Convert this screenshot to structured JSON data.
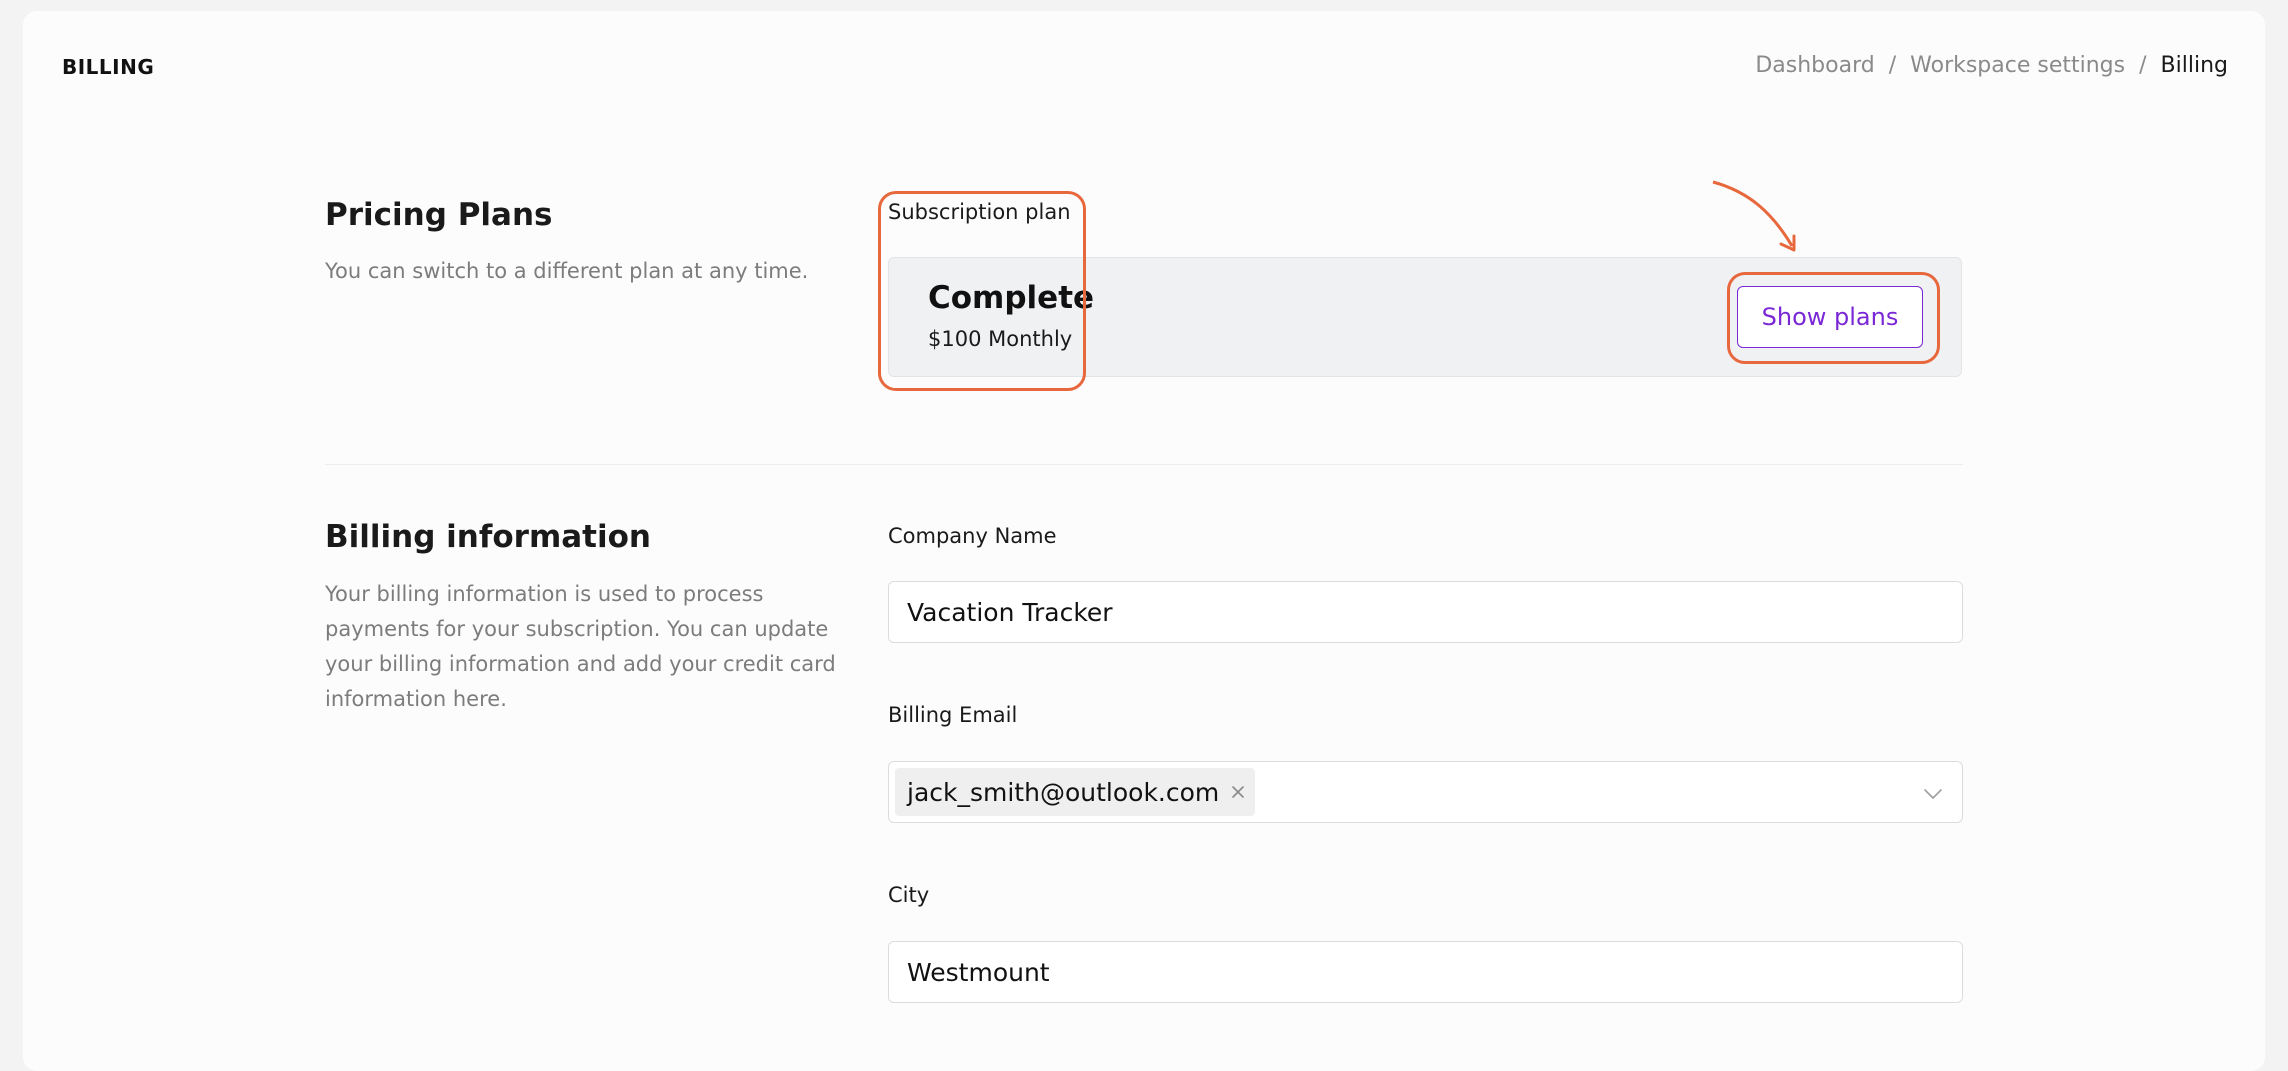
{
  "header": {
    "title": "BILLING",
    "breadcrumb": [
      "Dashboard",
      "Workspace settings",
      "Billing"
    ],
    "separator": "/"
  },
  "pricing": {
    "title": "Pricing Plans",
    "description": "You can switch to a different plan at any time.",
    "subscription_label": "Subscription plan",
    "plan_name": "Complete",
    "plan_price": "$100 Monthly",
    "show_plans_label": "Show plans"
  },
  "billing_info": {
    "title": "Billing information",
    "description": "Your billing information is used to process payments for your subscription. You can update your billing information and add your credit card information here.",
    "company_label": "Company Name",
    "company_value": "Vacation Tracker",
    "email_label": "Billing Email",
    "email_tag": "jack_smith@outlook.com",
    "city_label": "City",
    "city_value": "Westmount"
  },
  "colors": {
    "accent": "#7a28d6",
    "annotation": "#e8683d"
  },
  "icons": {
    "tag_remove": "close-icon",
    "select_chevron": "chevron-down-icon"
  }
}
